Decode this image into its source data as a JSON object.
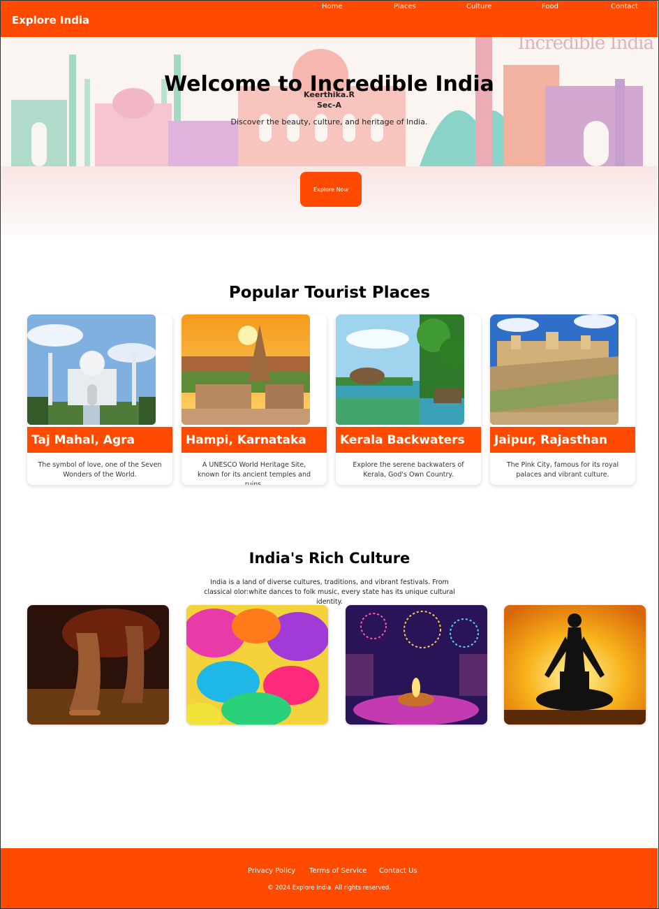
{
  "nav": {
    "brand": "Explore India",
    "links": [
      "Home",
      "Places",
      "Culture",
      "Food",
      "Contact"
    ]
  },
  "hero": {
    "title": "Welcome to Incredible India",
    "author": "Keerthika.R",
    "section": "Sec-A",
    "subtitle": "Discover the beauty, culture, and heritage of India.",
    "button": "Explore Now",
    "watermark": "Incredible India"
  },
  "places": {
    "title": "Popular Tourist Places",
    "cards": [
      {
        "name": "Taj Mahal, Agra",
        "desc": "The symbol of love, one of the Seven Wonders of the World.",
        "image": "taj-mahal-photo"
      },
      {
        "name": "Hampi, Karnataka",
        "desc": "A UNESCO World Heritage Site, known for its ancient temples and ruins.",
        "image": "hampi-temple-photo"
      },
      {
        "name": "Kerala Backwaters",
        "desc": "Explore the serene backwaters of Kerala, God's Own Country.",
        "image": "kerala-backwaters-photo"
      },
      {
        "name": "Jaipur, Rajasthan",
        "desc": "The Pink City, famous for its royal palaces and vibrant culture.",
        "image": "jaipur-fort-photo"
      }
    ]
  },
  "culture": {
    "title": "India's Rich Culture",
    "text": "India is a land of diverse cultures, traditions, and vibrant festivals. From classical olor:white dances to folk music, every state has its unique cultural identity.",
    "images": [
      "classical-dance-photo",
      "holi-colors-photo",
      "diwali-lamps-photo",
      "yoga-silhouette-photo"
    ]
  },
  "footer": {
    "links": [
      "Privacy Policy",
      "Terms of Service",
      "Contact Us"
    ],
    "copyright": "© 2024 Explore India. All rights reserved."
  },
  "colors": {
    "accent": "#ff4a00",
    "background": "#ffffff"
  }
}
